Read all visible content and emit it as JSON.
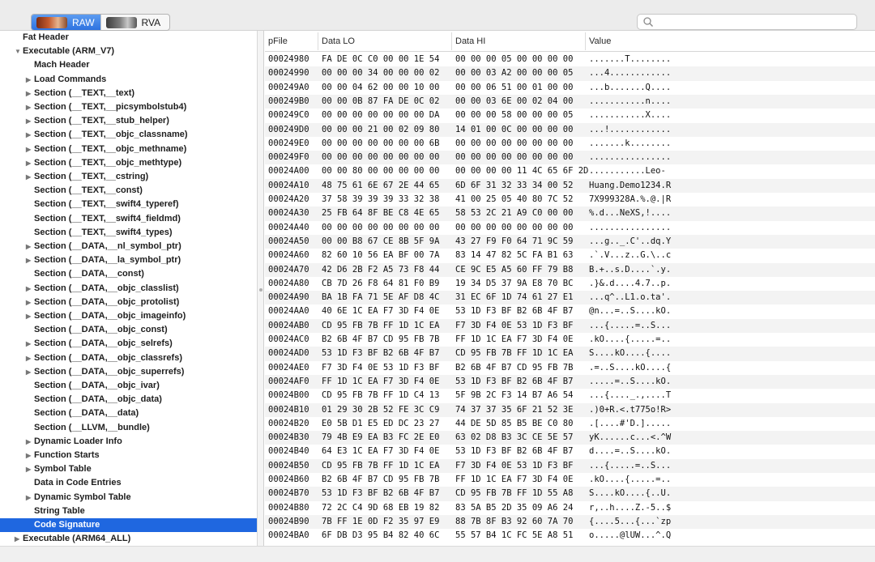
{
  "toolbar": {
    "tabs": [
      {
        "label": "RAW",
        "active": true
      },
      {
        "label": "RVA",
        "active": false
      }
    ],
    "search": {
      "placeholder": "",
      "value": ""
    }
  },
  "sidebar": {
    "selected_color": "#1f67e0",
    "items": [
      {
        "label": "Fat Header",
        "level": 0,
        "disclosure": "none"
      },
      {
        "label": "Executable  (ARM_V7)",
        "level": 0,
        "disclosure": "open"
      },
      {
        "label": "Mach Header",
        "level": 1,
        "disclosure": "none"
      },
      {
        "label": "Load Commands",
        "level": 1,
        "disclosure": "closed"
      },
      {
        "label": "Section (__TEXT,__text)",
        "level": 1,
        "disclosure": "closed"
      },
      {
        "label": "Section (__TEXT,__picsymbolstub4)",
        "level": 1,
        "disclosure": "closed"
      },
      {
        "label": "Section (__TEXT,__stub_helper)",
        "level": 1,
        "disclosure": "closed"
      },
      {
        "label": "Section (__TEXT,__objc_classname)",
        "level": 1,
        "disclosure": "closed"
      },
      {
        "label": "Section (__TEXT,__objc_methname)",
        "level": 1,
        "disclosure": "closed"
      },
      {
        "label": "Section (__TEXT,__objc_methtype)",
        "level": 1,
        "disclosure": "closed"
      },
      {
        "label": "Section (__TEXT,__cstring)",
        "level": 1,
        "disclosure": "closed"
      },
      {
        "label": "Section (__TEXT,__const)",
        "level": 1,
        "disclosure": "none"
      },
      {
        "label": "Section (__TEXT,__swift4_typeref)",
        "level": 1,
        "disclosure": "none"
      },
      {
        "label": "Section (__TEXT,__swift4_fieldmd)",
        "level": 1,
        "disclosure": "none"
      },
      {
        "label": "Section (__TEXT,__swift4_types)",
        "level": 1,
        "disclosure": "none"
      },
      {
        "label": "Section (__DATA,__nl_symbol_ptr)",
        "level": 1,
        "disclosure": "closed"
      },
      {
        "label": "Section (__DATA,__la_symbol_ptr)",
        "level": 1,
        "disclosure": "closed"
      },
      {
        "label": "Section (__DATA,__const)",
        "level": 1,
        "disclosure": "none"
      },
      {
        "label": "Section (__DATA,__objc_classlist)",
        "level": 1,
        "disclosure": "closed"
      },
      {
        "label": "Section (__DATA,__objc_protolist)",
        "level": 1,
        "disclosure": "closed"
      },
      {
        "label": "Section (__DATA,__objc_imageinfo)",
        "level": 1,
        "disclosure": "closed"
      },
      {
        "label": "Section (__DATA,__objc_const)",
        "level": 1,
        "disclosure": "none"
      },
      {
        "label": "Section (__DATA,__objc_selrefs)",
        "level": 1,
        "disclosure": "closed"
      },
      {
        "label": "Section (__DATA,__objc_classrefs)",
        "level": 1,
        "disclosure": "closed"
      },
      {
        "label": "Section (__DATA,__objc_superrefs)",
        "level": 1,
        "disclosure": "closed"
      },
      {
        "label": "Section (__DATA,__objc_ivar)",
        "level": 1,
        "disclosure": "none"
      },
      {
        "label": "Section (__DATA,__objc_data)",
        "level": 1,
        "disclosure": "none"
      },
      {
        "label": "Section (__DATA,__data)",
        "level": 1,
        "disclosure": "none"
      },
      {
        "label": "Section (__LLVM,__bundle)",
        "level": 1,
        "disclosure": "none"
      },
      {
        "label": "Dynamic Loader Info",
        "level": 1,
        "disclosure": "closed"
      },
      {
        "label": "Function Starts",
        "level": 1,
        "disclosure": "closed"
      },
      {
        "label": "Symbol Table",
        "level": 1,
        "disclosure": "closed"
      },
      {
        "label": "Data in Code Entries",
        "level": 1,
        "disclosure": "none"
      },
      {
        "label": "Dynamic Symbol Table",
        "level": 1,
        "disclosure": "closed"
      },
      {
        "label": "String Table",
        "level": 1,
        "disclosure": "none"
      },
      {
        "label": "Code Signature",
        "level": 1,
        "disclosure": "none",
        "selected": true
      },
      {
        "label": "Executable  (ARM64_ALL)",
        "level": 0,
        "disclosure": "closed"
      }
    ]
  },
  "table": {
    "columns": [
      "pFile",
      "Data LO",
      "Data HI",
      "Value"
    ],
    "rows": [
      [
        "00024980",
        "FA DE 0C C0 00 00 1E 54",
        "00 00 00 05 00 00 00 00",
        ".......T........"
      ],
      [
        "00024990",
        "00 00 00 34 00 00 00 02",
        "00 00 03 A2 00 00 00 05",
        "...4............"
      ],
      [
        "000249A0",
        "00 00 04 62 00 00 10 00",
        "00 00 06 51 00 01 00 00",
        "...b.......Q...."
      ],
      [
        "000249B0",
        "00 00 0B 87 FA DE 0C 02",
        "00 00 03 6E 00 02 04 00",
        "...........n...."
      ],
      [
        "000249C0",
        "00 00 00 00 00 00 00 DA",
        "00 00 00 58 00 00 00 05",
        "...........X...."
      ],
      [
        "000249D0",
        "00 00 00 21 00 02 09 80",
        "14 01 00 0C 00 00 00 00",
        "...!............"
      ],
      [
        "000249E0",
        "00 00 00 00 00 00 00 6B",
        "00 00 00 00 00 00 00 00",
        ".......k........"
      ],
      [
        "000249F0",
        "00 00 00 00 00 00 00 00",
        "00 00 00 00 00 00 00 00",
        "................"
      ],
      [
        "00024A00",
        "00 00 80 00 00 00 00 00",
        "00 00 00 00 11 4C 65 6F 2D",
        "...........Leo-"
      ],
      [
        "00024A10",
        "48 75 61 6E 67 2E 44 65",
        "6D 6F 31 32 33 34 00 52",
        "Huang.Demo1234.R"
      ],
      [
        "00024A20",
        "37 58 39 39 39 33 32 38",
        "41 00 25 05 40 80 7C 52",
        "7X999328A.%.@.|R"
      ],
      [
        "00024A30",
        "25 FB 64 8F BE C8 4E 65",
        "58 53 2C 21 A9 C0 00 00",
        "%.d...NeXS,!...."
      ],
      [
        "00024A40",
        "00 00 00 00 00 00 00 00",
        "00 00 00 00 00 00 00 00",
        "................"
      ],
      [
        "00024A50",
        "00 00 B8 67 CE 8B 5F 9A",
        "43 27 F9 F0 64 71 9C 59",
        "...g.._.C'..dq.Y"
      ],
      [
        "00024A60",
        "82 60 10 56 EA BF 00 7A",
        "83 14 47 82 5C FA B1 63",
        ".`.V...z..G.\\..c"
      ],
      [
        "00024A70",
        "42 D6 2B F2 A5 73 F8 44",
        "CE 9C E5 A5 60 FF 79 B8",
        "B.+..s.D....`.y."
      ],
      [
        "00024A80",
        "CB 7D 26 F8 64 81 F0 B9",
        "19 34 D5 37 9A E8 70 BC",
        ".}&.d....4.7..p."
      ],
      [
        "00024A90",
        "BA 1B FA 71 5E AF D8 4C",
        "31 EC 6F 1D 74 61 27 E1",
        "...q^..L1.o.ta'."
      ],
      [
        "00024AA0",
        "40 6E 1C EA F7 3D F4 0E",
        "53 1D F3 BF B2 6B 4F B7",
        "@n...=..S....kO."
      ],
      [
        "00024AB0",
        "CD 95 FB 7B FF 1D 1C EA",
        "F7 3D F4 0E 53 1D F3 BF",
        "...{.....=..S..."
      ],
      [
        "00024AC0",
        "B2 6B 4F B7 CD 95 FB 7B",
        "FF 1D 1C EA F7 3D F4 0E",
        ".kO....{.....=.."
      ],
      [
        "00024AD0",
        "53 1D F3 BF B2 6B 4F B7",
        "CD 95 FB 7B FF 1D 1C EA",
        "S....kO....{...."
      ],
      [
        "00024AE0",
        "F7 3D F4 0E 53 1D F3 BF",
        "B2 6B 4F B7 CD 95 FB 7B",
        ".=..S....kO....{"
      ],
      [
        "00024AF0",
        "FF 1D 1C EA F7 3D F4 0E",
        "53 1D F3 BF B2 6B 4F B7",
        ".....=..S....kO."
      ],
      [
        "00024B00",
        "CD 95 FB 7B FF 1D C4 13",
        "5F 9B 2C F3 14 B7 A6 54",
        "...{...._.,....T"
      ],
      [
        "00024B10",
        "01 29 30 2B 52 FE 3C C9",
        "74 37 37 35 6F 21 52 3E",
        ".)0+R.<.t775o!R>"
      ],
      [
        "00024B20",
        "E0 5B D1 E5 ED DC 23 27",
        "44 DE 5D 85 B5 BE C0 80",
        ".[....#'D.]....."
      ],
      [
        "00024B30",
        "79 4B E9 EA B3 FC 2E E0",
        "63 02 D8 B3 3C CE 5E 57",
        "yK......c...<.^W"
      ],
      [
        "00024B40",
        "64 E3 1C EA F7 3D F4 0E",
        "53 1D F3 BF B2 6B 4F B7",
        "d....=..S....kO."
      ],
      [
        "00024B50",
        "CD 95 FB 7B FF 1D 1C EA",
        "F7 3D F4 0E 53 1D F3 BF",
        "...{.....=..S..."
      ],
      [
        "00024B60",
        "B2 6B 4F B7 CD 95 FB 7B",
        "FF 1D 1C EA F7 3D F4 0E",
        ".kO....{.....=.."
      ],
      [
        "00024B70",
        "53 1D F3 BF B2 6B 4F B7",
        "CD 95 FB 7B FF 1D 55 A8",
        "S....kO....{..U."
      ],
      [
        "00024B80",
        "72 2C C4 9D 68 EB 19 82",
        "83 5A B5 2D 35 09 A6 24",
        "r,..h....Z.-5..$"
      ],
      [
        "00024B90",
        "7B FF 1E 0D F2 35 97 E9",
        "88 7B 8F B3 92 60 7A 70",
        "{....5...{...`zp"
      ],
      [
        "00024BA0",
        "6F DB D3 95 B4 82 40 6C",
        "55 57 B4 1C FC 5E A8 51",
        "o.....@lUW...^.Q"
      ]
    ]
  }
}
